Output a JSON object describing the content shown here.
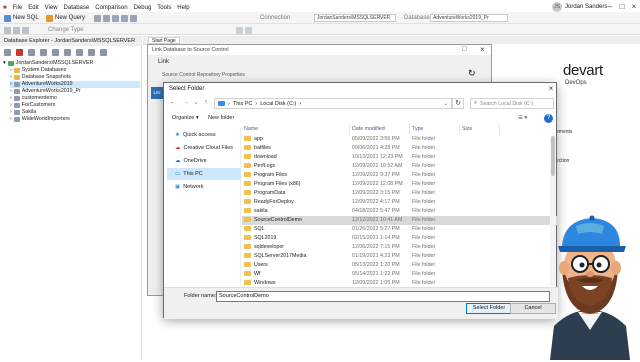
{
  "app": {
    "menus": [
      "File",
      "Edit",
      "View",
      "Database",
      "Comparison",
      "Debug",
      "Tools",
      "Help"
    ],
    "user_name": "Jordan Sanders",
    "user_initials": "JS"
  },
  "toolbar": {
    "new_sql": "New SQL",
    "new_query": "New Query",
    "change_type": "Change Type",
    "connection_label": "Connection",
    "connection_value": "JordanSanders\\MSSQLSERVER",
    "database_label": "Database",
    "database_value": "AdventureWorks2019_Pr"
  },
  "explorer": {
    "title": "Database Explorer - JordanSanders\\MSSQLSERVER",
    "server": "JordanSanders\\MSSQLSERVER",
    "items": [
      "System Databases",
      "Database Snapshots",
      "AdventureWorks2019",
      "AdventureWorks2019_Pr",
      "customerdemo",
      "ForCustomers",
      "Sakila",
      "WideWorldImporters"
    ]
  },
  "tabs": {
    "start_page": "Start Page"
  },
  "bg_window": {
    "title": "Link Database to Source Control",
    "link": "Link",
    "props": "Source Control Repository Properties"
  },
  "right_panel": {
    "brand": "devart",
    "devops": "DevOps",
    "text1": "ements",
    "text2": "ection"
  },
  "dialog": {
    "title": "Select Folder",
    "address": [
      "This PC",
      "Local Disk (C:)"
    ],
    "search_placeholder": "Search Local Disk (C:)",
    "organize": "Organize",
    "new_folder": "New folder",
    "nav": [
      "Quick access",
      "Creative Cloud Files",
      "OneDrive",
      "This PC",
      "Network"
    ],
    "columns": [
      "Name",
      "Date modified",
      "Type",
      "Size"
    ],
    "files": [
      {
        "name": "app",
        "date": "05/09/2022 3:56 PM",
        "type": "File folder"
      },
      {
        "name": "batfiles",
        "date": "09/06/2021 4:28 PM",
        "type": "File folder"
      },
      {
        "name": "download",
        "date": "10/13/2021 12:23 PM",
        "type": "File folder"
      },
      {
        "name": "PerfLogs",
        "date": "12/09/2022 10:52 AM",
        "type": "File folder"
      },
      {
        "name": "Program Files",
        "date": "12/09/2022 9:37 PM",
        "type": "File folder"
      },
      {
        "name": "Program Files (x86)",
        "date": "12/09/2022 12:08 PM",
        "type": "File folder"
      },
      {
        "name": "ProgramData",
        "date": "12/09/2022 3:15 PM",
        "type": "File folder"
      },
      {
        "name": "ReadyForDeploy",
        "date": "12/09/2022 4:17 PM",
        "type": "File folder"
      },
      {
        "name": "sakila",
        "date": "04/18/2022 5:47 PM",
        "type": "File folder"
      },
      {
        "name": "SourceControlDemo",
        "date": "12/12/2022 10:41 AM",
        "type": "File folder"
      },
      {
        "name": "SQL",
        "date": "01/26/2022 5:27 PM",
        "type": "File folder"
      },
      {
        "name": "SQL2019",
        "date": "02/15/2021 1:14 PM",
        "type": "File folder"
      },
      {
        "name": "sqldeveloper",
        "date": "12/06/2022 7:15 PM",
        "type": "File folder"
      },
      {
        "name": "SQLServer2017Media",
        "date": "01/19/2021 4:23 PM",
        "type": "File folder"
      },
      {
        "name": "Users",
        "date": "05/13/2022 1:20 PM",
        "type": "File folder"
      },
      {
        "name": "Wf",
        "date": "05/14/2021 1:22 PM",
        "type": "File folder"
      },
      {
        "name": "Windows",
        "date": "12/09/2022 1:05 PM",
        "type": "File folder"
      }
    ],
    "selected_file": "SourceControlDemo",
    "folder_label": "Folder name:",
    "folder_value": "SourceControlDemo",
    "select_button": "Select Folder",
    "cancel_button": "Cancel"
  },
  "colors": {
    "accent": "#0078d7",
    "selection": "#cce8ff",
    "folder": "#f1c14b"
  }
}
